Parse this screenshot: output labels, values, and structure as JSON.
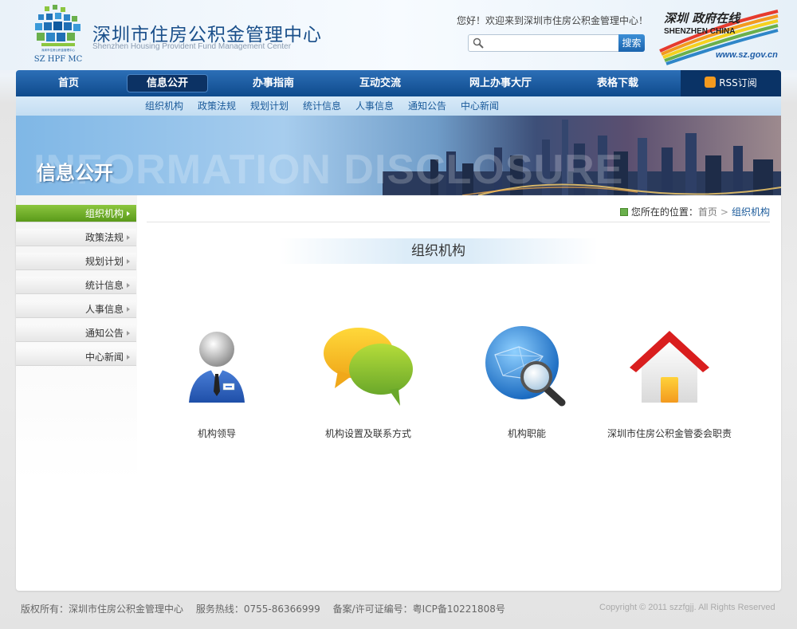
{
  "header": {
    "title": "深圳市住房公积金管理中心",
    "subtitle": "Shenzhen Housing Provident Fund Management Center",
    "logo_text": "SZ HPF MC",
    "welcome": "您好！欢迎来到深圳市住房公积金管理中心！",
    "search_placeholder": "",
    "search_button": "搜索",
    "sz_logo": {
      "cn": "深圳 政府在线",
      "en": "SHENZHEN CHINA",
      "url": "www.sz.gov.cn"
    }
  },
  "nav": {
    "items": [
      {
        "label": "首页"
      },
      {
        "label": "信息公开",
        "active": true
      },
      {
        "label": "办事指南"
      },
      {
        "label": "互动交流"
      },
      {
        "label": "网上办事大厅"
      },
      {
        "label": "表格下载"
      }
    ],
    "rss": "RSS订阅"
  },
  "subnav": {
    "items": [
      "组织机构",
      "政策法规",
      "规划计划",
      "统计信息",
      "人事信息",
      "通知公告",
      "中心新闻"
    ]
  },
  "banner": {
    "title": "信息公开",
    "watermark": "INFORMATION DISCLOSURE"
  },
  "sidebar": {
    "items": [
      {
        "label": "组织机构",
        "active": true
      },
      {
        "label": "政策法规"
      },
      {
        "label": "规划计划"
      },
      {
        "label": "统计信息"
      },
      {
        "label": "人事信息"
      },
      {
        "label": "通知公告"
      },
      {
        "label": "中心新闻"
      }
    ]
  },
  "breadcrumb": {
    "prefix": "您所在的位置：",
    "home": "首页",
    "current": "组织机构"
  },
  "section": {
    "title": "组织机构",
    "tiles": [
      {
        "label": "机构领导",
        "icon": "leader-icon"
      },
      {
        "label": "机构设置及联系方式",
        "icon": "chat-bubbles-icon"
      },
      {
        "label": "机构职能",
        "icon": "globe-search-icon"
      },
      {
        "label": "深圳市住房公积金管委会职责",
        "icon": "house-icon"
      }
    ]
  },
  "footer": {
    "copyright_owner": "版权所有：深圳市住房公积金管理中心",
    "hotline": "服务热线：0755-86366999",
    "icp": "备案/许可证编号：粤ICP备10221808号",
    "copyright_en": "Copyright © 2011 szzfgjj. All Rights Reserved"
  },
  "colors": {
    "nav_blue": "#1a5a9a",
    "active_green": "#6aa82a",
    "accent_orange": "#f39a1f"
  }
}
